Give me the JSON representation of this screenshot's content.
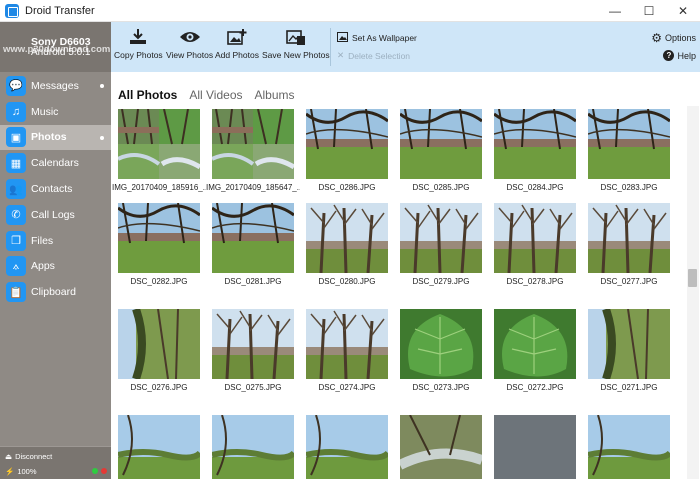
{
  "window": {
    "title": "Droid Transfer",
    "minimize": "—",
    "maximize": "☐",
    "close": "✕"
  },
  "device": {
    "name": "Sony D6603",
    "os": "Android 5.0.1",
    "watermark": "www.p30download.com نرم افزار ایران"
  },
  "sidebar": {
    "items": [
      {
        "label": "Messages",
        "icon": "messages-icon",
        "glyph": "💬",
        "dot": true,
        "active": false
      },
      {
        "label": "Music",
        "icon": "music-icon",
        "glyph": "♫",
        "dot": false,
        "active": false
      },
      {
        "label": "Photos",
        "icon": "photos-icon",
        "glyph": "▣",
        "dot": true,
        "active": true
      },
      {
        "label": "Calendars",
        "icon": "calendar-icon",
        "glyph": "▦",
        "dot": false,
        "active": false
      },
      {
        "label": "Contacts",
        "icon": "contacts-icon",
        "glyph": "👥",
        "dot": false,
        "active": false
      },
      {
        "label": "Call Logs",
        "icon": "phone-icon",
        "glyph": "✆",
        "dot": false,
        "active": false
      },
      {
        "label": "Files",
        "icon": "files-icon",
        "glyph": "❐",
        "dot": false,
        "active": false
      },
      {
        "label": "Apps",
        "icon": "apps-icon",
        "glyph": "⟑",
        "dot": false,
        "active": false
      },
      {
        "label": "Clipboard",
        "icon": "clipboard-icon",
        "glyph": "📋",
        "dot": false,
        "active": false
      }
    ],
    "disconnect": "Disconnect",
    "battery": "100%",
    "status_colors": [
      "#2ecc40",
      "#e53935"
    ]
  },
  "toolbar": {
    "copy_photos": "Copy Photos",
    "view_photos": "View Photos",
    "add_photos": "Add Photos",
    "save_new_photos": "Save New Photos",
    "set_as_wallpaper": "Set As Wallpaper",
    "delete_selection": "Delete Selection",
    "options": "Options",
    "help": "Help"
  },
  "tabs": [
    {
      "label": "All Photos",
      "active": true
    },
    {
      "label": "All Videos",
      "active": false
    },
    {
      "label": "Albums",
      "active": false
    }
  ],
  "photos": [
    {
      "name": "IMG_20170409_185916_...",
      "style": "collage"
    },
    {
      "name": "IMG_20170409_185647_...",
      "style": "collage"
    },
    {
      "name": "DSC_0286.JPG",
      "style": "field"
    },
    {
      "name": "DSC_0285.JPG",
      "style": "field"
    },
    {
      "name": "DSC_0284.JPG",
      "style": "field"
    },
    {
      "name": "DSC_0283.JPG",
      "style": "field"
    },
    {
      "name": "DSC_0282.JPG",
      "style": "field"
    },
    {
      "name": "DSC_0281.JPG",
      "style": "field"
    },
    {
      "name": "DSC_0280.JPG",
      "style": "trees"
    },
    {
      "name": "DSC_0279.JPG",
      "style": "trees"
    },
    {
      "name": "DSC_0278.JPG",
      "style": "trees"
    },
    {
      "name": "DSC_0277.JPG",
      "style": "trees"
    },
    {
      "name": "DSC_0276.JPG",
      "style": "hedge"
    },
    {
      "name": "DSC_0275.JPG",
      "style": "trees"
    },
    {
      "name": "DSC_0274.JPG",
      "style": "trees"
    },
    {
      "name": "DSC_0273.JPG",
      "style": "leaf"
    },
    {
      "name": "DSC_0272.JPG",
      "style": "leaf"
    },
    {
      "name": "DSC_0271.JPG",
      "style": "hedge"
    },
    {
      "name": "",
      "style": "sky"
    },
    {
      "name": "",
      "style": "sky"
    },
    {
      "name": "",
      "style": "sky"
    },
    {
      "name": "",
      "style": "stream"
    },
    {
      "name": "",
      "style": "grey"
    },
    {
      "name": "",
      "style": "sky"
    }
  ]
}
